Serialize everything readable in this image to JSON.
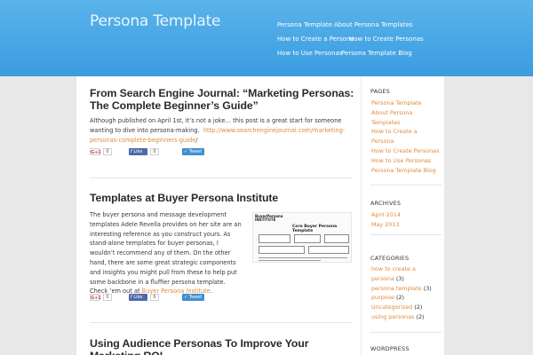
{
  "header": {
    "site_title": "Persona Template",
    "nav": [
      {
        "label": "Persona Template"
      },
      {
        "label": "About Persona Templates"
      },
      {
        "label": "How to Create a Persona"
      },
      {
        "label": "How to Create Personas"
      },
      {
        "label": "How to Use Personas"
      },
      {
        "label": "Persona Template Blog"
      }
    ]
  },
  "posts": [
    {
      "title": "From Search Engine Journal: “Marketing Personas: The Complete Beginner’s Guide”",
      "text_1": "Although published on April 1st, it’s not a joke… this post is a great start for someone",
      "text_2": "wanting to dive into persona-making.",
      "link_a": "http://www.searchenginejournal.com/marketing-",
      "link_b": "personas-complete-beginners-guide",
      "text_3": "/",
      "share": {
        "gplus": "G+1",
        "gplus_count": "0",
        "like": "Like",
        "like_count": "0",
        "tweet": "Tweet"
      }
    },
    {
      "title": "Templates at Buyer Persona Institute",
      "lines": [
        "The buyer persona and message development",
        "templates Adele Revella provides on her site are an",
        "interesting reference as you construct yours. As",
        "stand-alone templates for buyer personas, I",
        "wouldn’t recommend any of them. On the other",
        "hand, there are some great strategic components",
        "and insights you might pull from these to help put",
        "some backbone in a fluffier persona template."
      ],
      "last_prefix": "Check ’em out at ",
      "last_link": "Buyer Persona Institute",
      "last_suffix": ".",
      "thumb": {
        "logo_1": "BuyerPersona",
        "logo_2": "INSTITUTE",
        "title_1": "Core Buyer Persona",
        "title_2": "Template"
      },
      "share": {
        "gplus": "G+1",
        "gplus_count": "0",
        "like": "Like",
        "like_count": "0",
        "tweet": "Tweet"
      }
    },
    {
      "title": "Using Audience Personas To Improve Your Marketing ROI"
    }
  ],
  "sidebar": {
    "pages_heading": "PAGES",
    "pages": [
      "Persona Template",
      "About Persona",
      "Templates",
      "How to Create a",
      "Persona",
      "How to Create Personas",
      "How to Use Personas",
      "Persona Template Blog"
    ],
    "archives_heading": "ARCHIVES",
    "archives": [
      "April 2014",
      "May 2013"
    ],
    "categories_heading": "CATEGORIES",
    "categories": [
      {
        "name": "how to create a",
        "name2": "persona",
        "count": " (3)"
      },
      {
        "name": "persona template",
        "count": " (3)"
      },
      {
        "name": "purpose",
        "count": " (2)"
      },
      {
        "name": "Uncategorized",
        "count": " (2)"
      },
      {
        "name": "using personas",
        "count": " (2)"
      }
    ],
    "wordpress_heading": "WORDPRESS"
  },
  "colors": {
    "header": "#4aa9e6",
    "link": "#e08a3c",
    "facebook": "#4d6aa8",
    "twitter": "#3f8fd0"
  }
}
